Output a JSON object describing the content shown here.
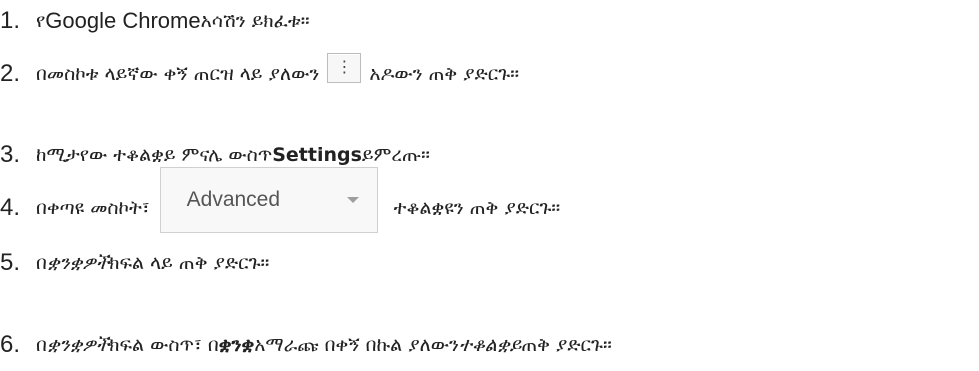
{
  "steps": [
    {
      "number": "1.",
      "prefix": "የ",
      "app_name": "Google Chrome",
      "text": " አሳሽን ይክፈቱ።"
    },
    {
      "number": "2.",
      "text_before": "በመስኮቱ ላይኛው ቀኝ ጠርዝ ላይ ያለውን",
      "button_glyph": "⋮",
      "text_after": "አዶውን ጠቅ ያድርጉ።"
    },
    {
      "number": "3.",
      "text_before": "ከሚታየው ተቆልቋይ ምናሌ ውስጥ ",
      "settings_label": "Settings",
      "text_after": " ይምረጡ።"
    },
    {
      "number": "4.",
      "text_before": "በቀጣዩ መስኮት፣",
      "dropdown_label": "Advanced",
      "text_after": "ተቆልቋዩን ጠቅ ያድርጉ።"
    },
    {
      "number": "5.",
      "prefix": "በ ",
      "section": "ቋንቋዎች",
      "text_after": " ክፍል ላይ ጠቅ ያድርጉ።"
    },
    {
      "number": "6.",
      "prefix": "በ ",
      "section": "ቋንቋዎች",
      "middle": " ክፍል ውስጥ፣ በ ",
      "option": "ቋንቋ",
      "text_mid2": " አማራጩ በቀኝ በኩል ያለውን ",
      "dropdown_word": "ተቆልቋይ",
      "text_after": " ጠቅ ያድርጉ።"
    }
  ]
}
